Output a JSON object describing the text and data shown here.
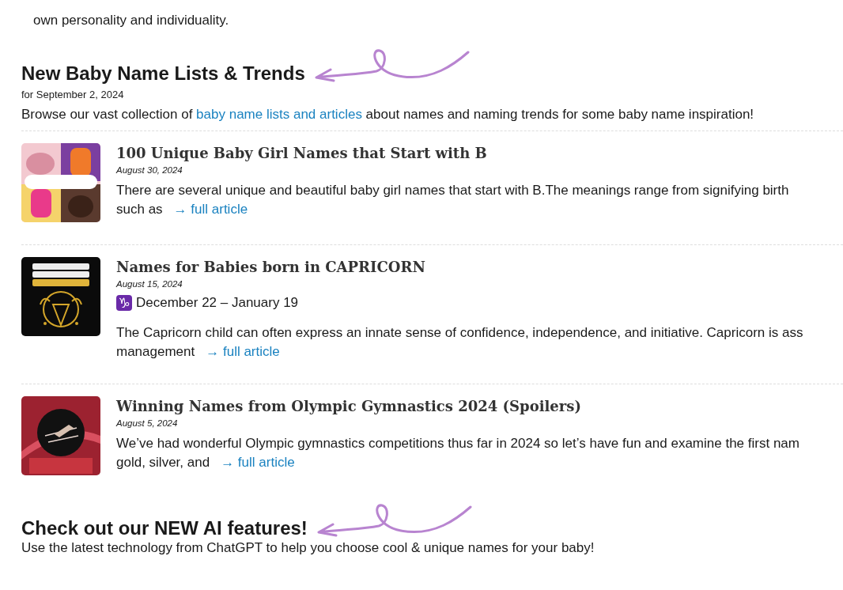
{
  "intro_item": {
    "text_line_2": "own personality and individuality."
  },
  "trends": {
    "heading": "New Baby Name Lists & Trends",
    "date": "for September 2, 2024",
    "lead_before": "Browse our vast collection of ",
    "lead_link": "baby name lists and articles",
    "lead_after": " about names and naming trends for some baby name inspiration!"
  },
  "articles": [
    {
      "kind": "picture",
      "title": "100 Unique Baby Girl Names that Start with B",
      "date": "August 30, 2024",
      "lines": [
        "There are several unique and beautiful baby girl names that start with B.The meanings range from signifying birth",
        "such as"
      ],
      "link": "→ full article"
    },
    {
      "kind": "picture",
      "title": "Names for Babies born in CAPRICORN",
      "date": "August 15, 2024",
      "sign": "♑",
      "range": "December 22 – January 19",
      "lines": [
        "The Capricorn child can often express an innate sense of confidence, independence, and initiative. Capricorn is ass",
        "management"
      ],
      "link": "→ full article"
    },
    {
      "kind": "picture",
      "title": "Winning Names from Olympic Gymnastics 2024 (Spoilers)",
      "date": "August 5, 2024",
      "lines": [
        "We’ve had wonderful Olympic gymnastics competitions thus far in 2024 so let’s have fun and examine the first nam",
        "gold, silver, and"
      ],
      "link": "→ full article"
    }
  ],
  "ai": {
    "heading": "Check out our NEW AI features!",
    "text": "Use the latest technology from ChatGPT to help you choose cool & unique names for your baby!"
  }
}
